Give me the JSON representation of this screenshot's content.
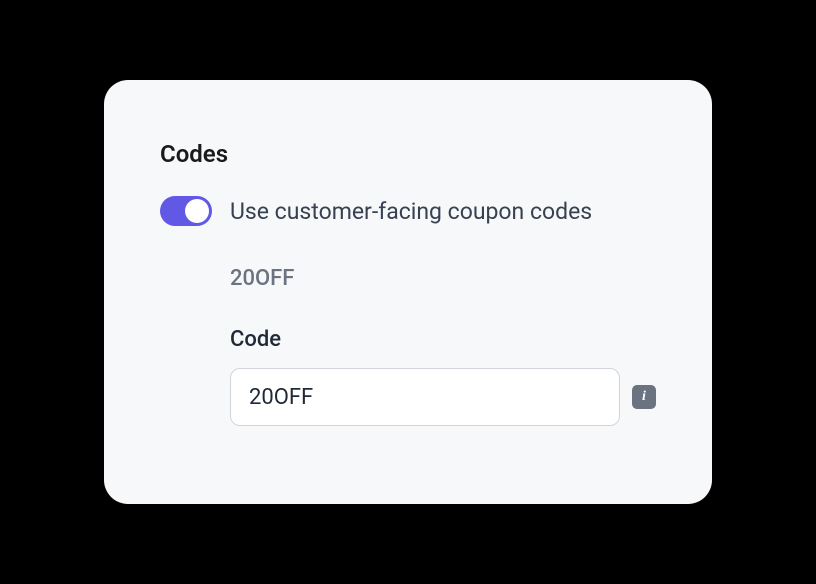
{
  "section": {
    "title": "Codes"
  },
  "toggle": {
    "label": "Use customer-facing coupon codes",
    "enabled": true
  },
  "codePreview": "20OFF",
  "field": {
    "label": "Code",
    "value": "20OFF"
  },
  "icons": {
    "info": "i"
  },
  "colors": {
    "accent": "#6158e6",
    "cardBg": "#f7f8fa"
  }
}
